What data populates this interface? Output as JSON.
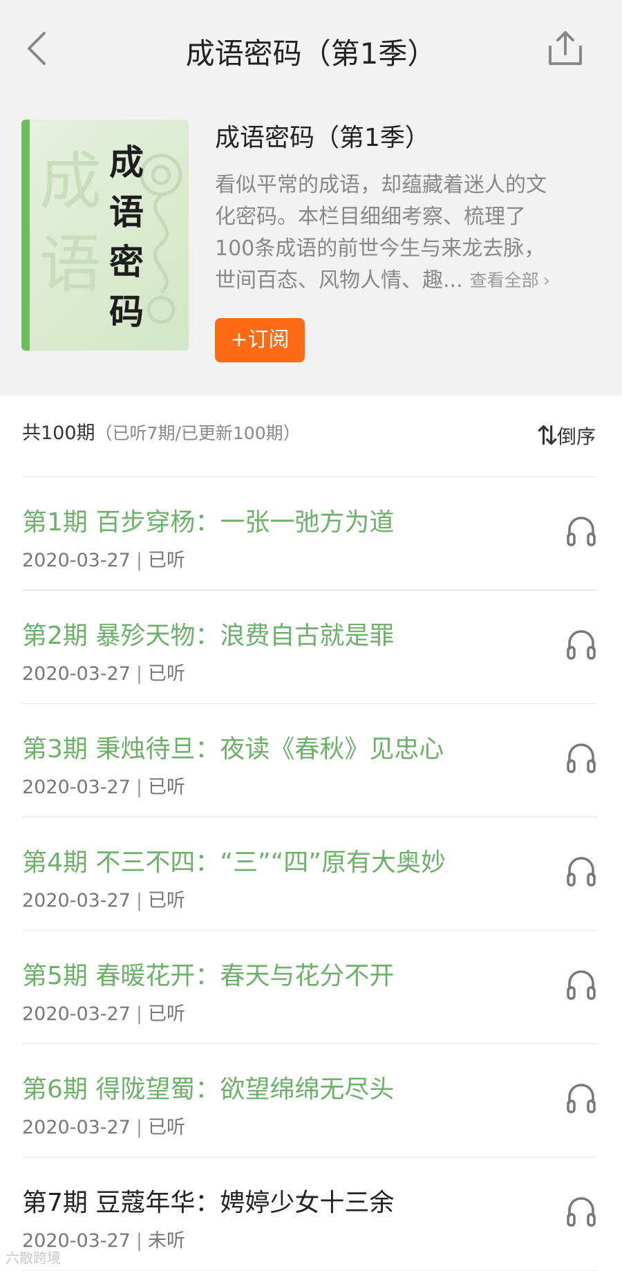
{
  "nav": {
    "title": "成语密码（第1季）"
  },
  "album": {
    "cover_text": [
      "成",
      "语",
      "密",
      "码"
    ],
    "cover_watermark": "成\n语",
    "title": "成语密码（第1季）",
    "description_lines": [
      "看似平常的成语，却蕴藏着迷人的文",
      "化密码。本栏目细细考察、梳理了",
      "100条成语的前世今生与来龙去脉，"
    ],
    "description_last": "世间百态、风物人情、趣...",
    "see_all": "查看全部",
    "subscribe_label": "+订阅"
  },
  "list": {
    "count_main": "共100期",
    "count_sub": "（已听7期/已更新100期）",
    "sort_label": "倒序",
    "episodes": [
      {
        "title": "第1期 百步穿杨：一张一弛方为道",
        "date": "2020-03-27",
        "status": "已听"
      },
      {
        "title": "第2期 暴殄天物：浪费自古就是罪",
        "date": "2020-03-27",
        "status": "已听"
      },
      {
        "title": "第3期 秉烛待旦：夜读《春秋》见忠心",
        "date": "2020-03-27",
        "status": "已听"
      },
      {
        "title": "第4期 不三不四：“三”“四”原有大奥妙",
        "date": "2020-03-27",
        "status": "已听"
      },
      {
        "title": "第5期 春暖花开：春天与花分不开",
        "date": "2020-03-27",
        "status": "已听"
      },
      {
        "title": "第6期 得陇望蜀：欲望绵绵无尽头",
        "date": "2020-03-27",
        "status": "已听"
      },
      {
        "title": "第7期 豆蔻年华：娉婷少女十三余",
        "date": "2020-03-27",
        "status": "未听"
      }
    ]
  },
  "watermark": "六散跨境",
  "colors": {
    "accent": "#ff6a14",
    "listened": "#6db06a",
    "cover_bar": "#6abf5a"
  },
  "icons": {
    "back": "chevron-left-icon",
    "share": "share-icon",
    "sort": "sort-icon",
    "play": "headphones-icon"
  }
}
